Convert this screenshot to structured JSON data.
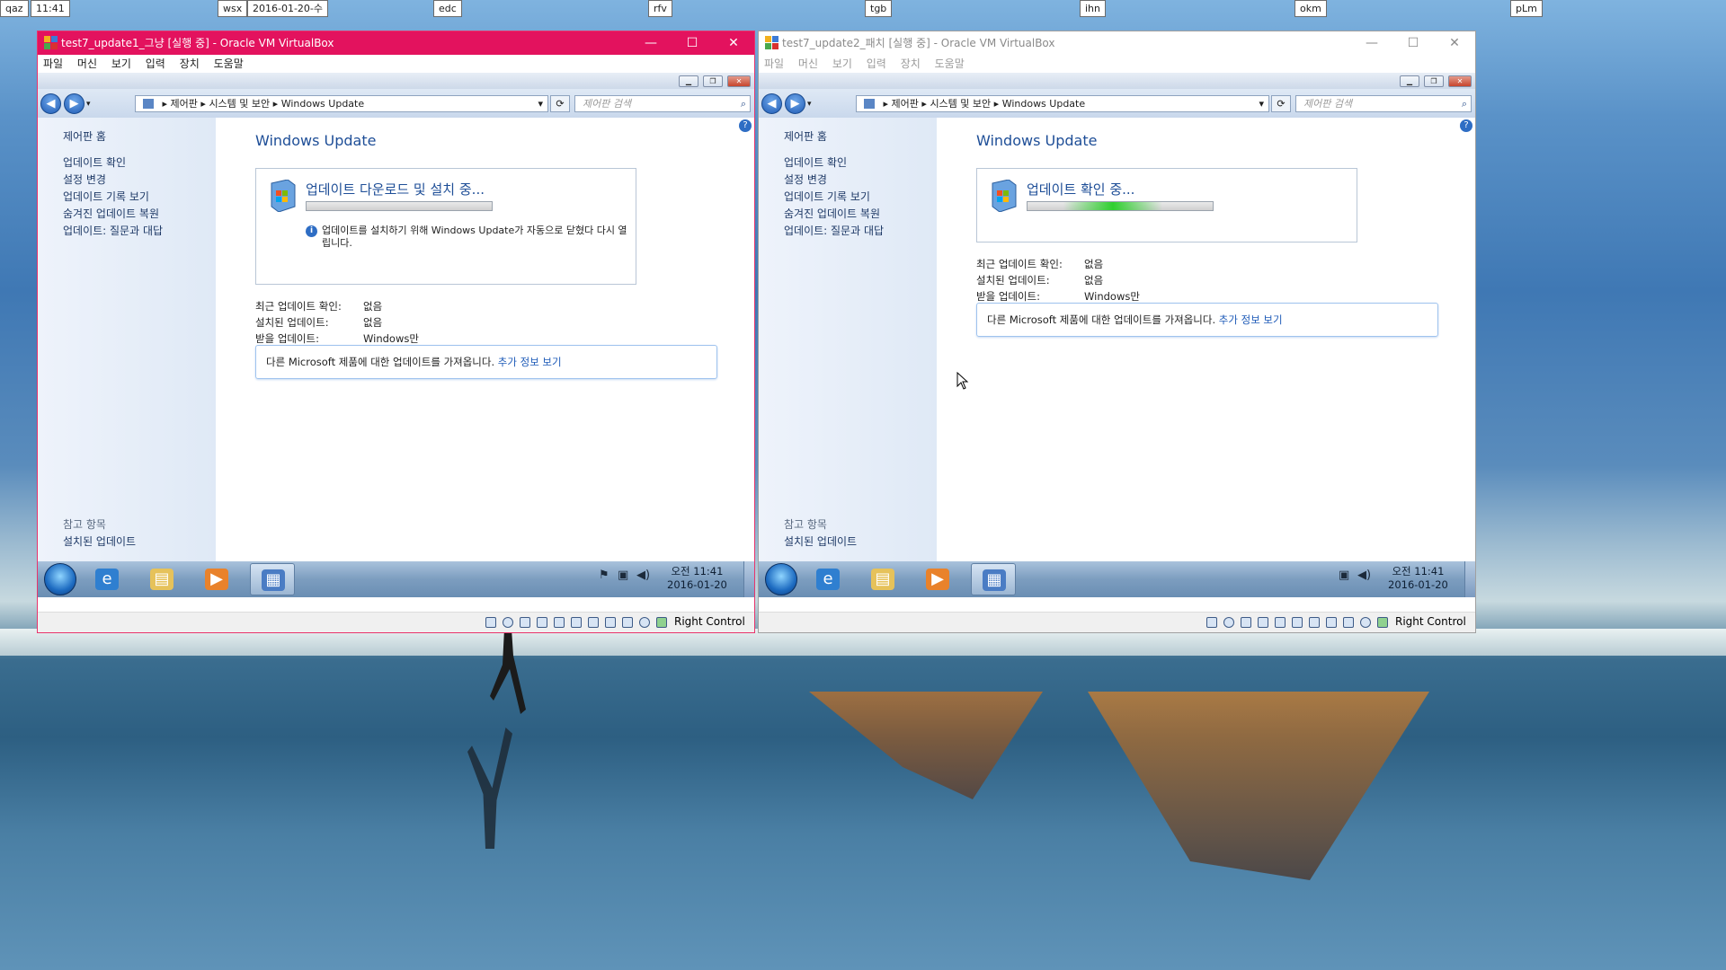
{
  "top_tags": [
    {
      "label": "qaz"
    },
    {
      "label": "11:41"
    },
    {
      "label": "wsx"
    },
    {
      "label": "2016-01-20-수"
    },
    {
      "label": "edc"
    },
    {
      "label": "rfv"
    },
    {
      "label": "tgb"
    },
    {
      "label": "ihn"
    },
    {
      "label": "okm"
    },
    {
      "label": "pLm"
    }
  ],
  "colors": {
    "active_titlebar": "#e3125e",
    "link": "#1e5bb8",
    "heading": "#1e4e97",
    "progress_green": "#1fb71f"
  },
  "vm1": {
    "title": "test7_update1_그냥 [실행 중] - Oracle VM VirtualBox",
    "title_controls": {
      "minimize": "—",
      "maximize": "☐",
      "close": "✕"
    },
    "menu": [
      "파일",
      "머신",
      "보기",
      "입력",
      "장치",
      "도움말"
    ],
    "nav": {
      "back": "◀",
      "forward": "▶"
    },
    "address": {
      "sep": "▸",
      "crumbs": [
        "제어판",
        "시스템 및 보안",
        "Windows Update"
      ],
      "dropdown": "▾"
    },
    "search_placeholder": "제어판 검색",
    "sidebar": {
      "home": "제어판 홈",
      "links": [
        "업데이트 확인",
        "설정 변경",
        "업데이트 기록 보기",
        "숨겨진 업데이트 복원",
        "업데이트: 질문과 대답"
      ],
      "see_also": "참고 항목",
      "installed": "설치된 업데이트"
    },
    "heading": "Windows Update",
    "status_title": "업데이트 다운로드 및 설치 중...",
    "progress": 0,
    "info_text": "업데이트를 설치하기 위해 Windows Update가 자동으로 닫혔다 다시 열립니다.",
    "details": [
      {
        "key": "최근 업데이트 확인:",
        "value": "없음"
      },
      {
        "key": "설치된 업데이트:",
        "value": "없음"
      },
      {
        "key": "받을 업데이트:",
        "value": "Windows만"
      }
    ],
    "ms_text": "다른 Microsoft 제품에 대한 업데이트를 가져옵니다.",
    "ms_link": "추가 정보 보기",
    "clock_time": "오전 11:41",
    "clock_date": "2016-01-20",
    "host_key": "Right Control"
  },
  "vm2": {
    "title": "test7_update2_패치 [실행 중] - Oracle VM VirtualBox",
    "title_controls": {
      "minimize": "—",
      "maximize": "☐",
      "close": "✕"
    },
    "menu": [
      "파일",
      "머신",
      "보기",
      "입력",
      "장치",
      "도움말"
    ],
    "nav": {
      "back": "◀",
      "forward": "▶"
    },
    "address": {
      "sep": "▸",
      "crumbs": [
        "제어판",
        "시스템 및 보안",
        "Windows Update"
      ],
      "dropdown": "▾"
    },
    "search_placeholder": "제어판 검색",
    "sidebar": {
      "home": "제어판 홈",
      "links": [
        "업데이트 확인",
        "설정 변경",
        "업데이트 기록 보기",
        "숨겨진 업데이트 복원",
        "업데이트: 질문과 대답"
      ],
      "see_also": "참고 항목",
      "installed": "설치된 업데이트"
    },
    "heading": "Windows Update",
    "status_title": "업데이트 확인 중...",
    "progress_indeterminate": true,
    "details": [
      {
        "key": "최근 업데이트 확인:",
        "value": "없음"
      },
      {
        "key": "설치된 업데이트:",
        "value": "없음"
      },
      {
        "key": "받을 업데이트:",
        "value": "Windows만"
      }
    ],
    "ms_text": "다른 Microsoft 제품에 대한 업데이트를 가져옵니다.",
    "ms_link": "추가 정보 보기",
    "clock_time": "오전 11:41",
    "clock_date": "2016-01-20",
    "host_key": "Right Control"
  }
}
